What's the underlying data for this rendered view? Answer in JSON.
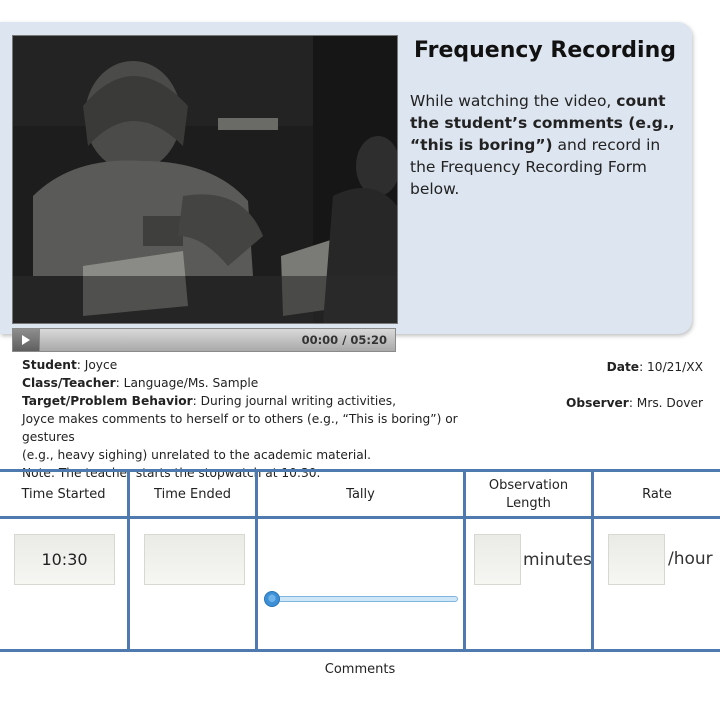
{
  "video": {
    "time": "00:00 / 05:20",
    "play_icon": "play-icon"
  },
  "header": {
    "title": "Frequency Recording",
    "instr_pre": "While watching the video, ",
    "instr_bold": "count the student’s comments (e.g., “this is boring”)",
    "instr_post": " and record in the Frequency Recording Form below."
  },
  "info": {
    "student_label": "Student",
    "student": ": Joyce",
    "class_label": "Class/Teacher",
    "class": ": Language/Ms. Sample",
    "target_label": "Target/Problem Behavior",
    "target_1": ": During journal writing activities,",
    "target_2": "Joyce makes comments to herself or to others (e.g., “This is boring”) or gestures",
    "target_3": "(e.g., heavy sighing) unrelated to the academic material.",
    "note": "Note: The teacher starts the stopwatch at 10:30.",
    "date_label": "Date",
    "date": ": 10/21/XX",
    "observer_label": "Observer",
    "observer": ": Mrs. Dover"
  },
  "table": {
    "headers": {
      "time_started": "Time Started",
      "time_ended": "Time Ended",
      "tally": "Tally",
      "obs_length_1": "Observation",
      "obs_length_2": "Length",
      "rate": "Rate"
    },
    "time_started_value": "10:30",
    "time_ended_value": "",
    "tally_value": 0,
    "obs_length_value": "",
    "obs_length_unit": "minutes",
    "rate_value": "",
    "rate_unit": "/hour",
    "comments_label": "Comments"
  },
  "colors": {
    "panel": "#dde5f0",
    "table_lines": "#4f7ab0",
    "slider": "#3d8fd6"
  }
}
